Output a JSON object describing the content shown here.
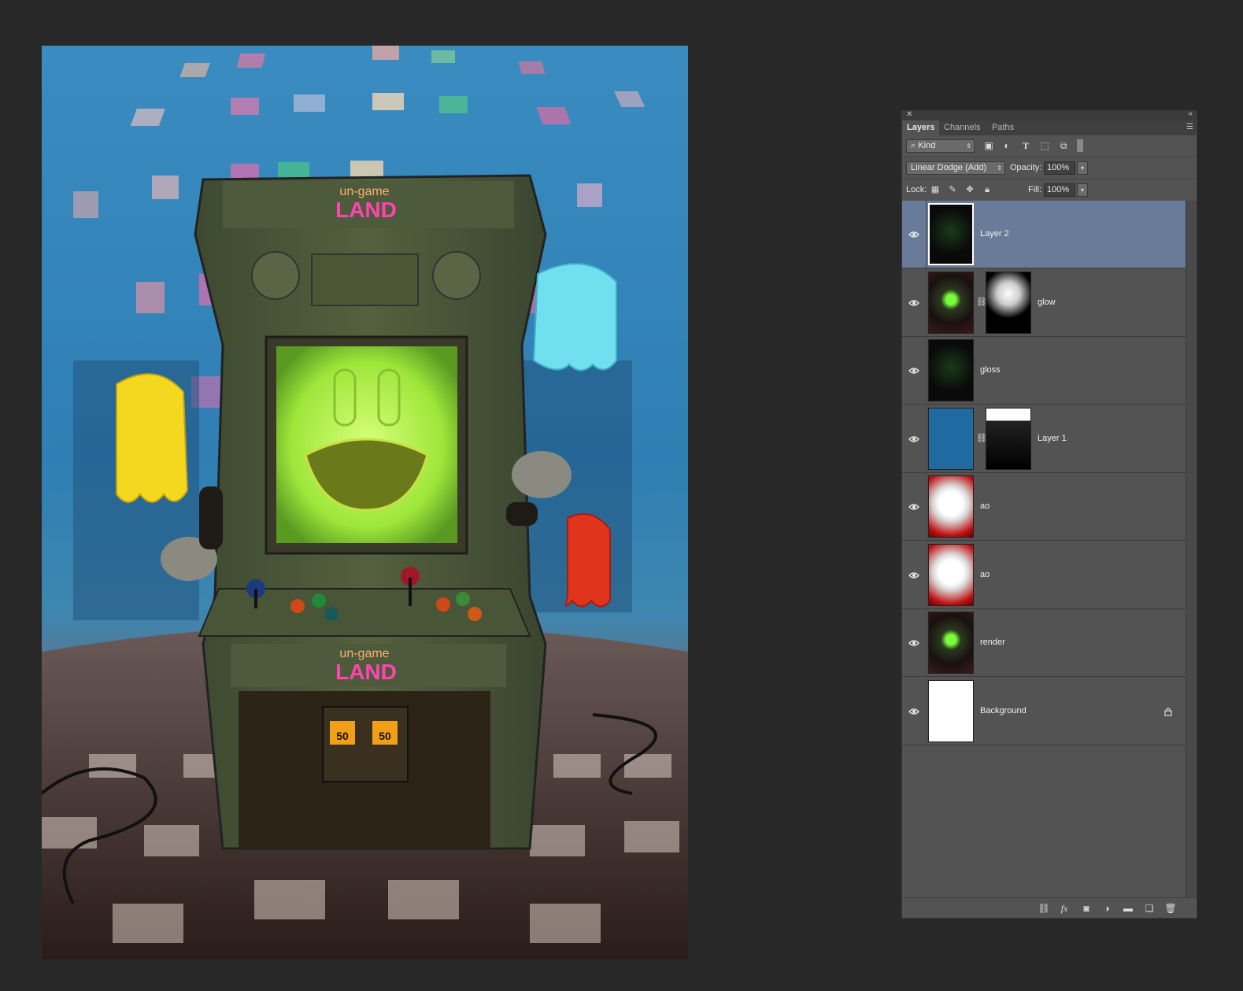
{
  "panel": {
    "tabs": [
      "Layers",
      "Channels",
      "Paths"
    ],
    "active_tab": "Layers",
    "filter": {
      "label": "Kind"
    },
    "blend_mode": "Linear Dodge (Add)",
    "opacity_label": "Opacity:",
    "opacity": "100%",
    "lock_label": "Lock:",
    "fill_label": "Fill:",
    "fill": "100%",
    "layers": [
      {
        "name": "Layer 2",
        "selected": true,
        "thumb": "dark-render",
        "mask": null,
        "locked": false
      },
      {
        "name": "glow",
        "selected": false,
        "thumb": "render",
        "mask": "radial-white",
        "locked": false
      },
      {
        "name": "gloss",
        "selected": false,
        "thumb": "dark-render",
        "mask": null,
        "locked": false
      },
      {
        "name": "Layer 1",
        "selected": false,
        "thumb": "solid-blue",
        "mask": "silhouette",
        "locked": false
      },
      {
        "name": "ao",
        "selected": false,
        "thumb": "ao",
        "mask": null,
        "locked": false
      },
      {
        "name": "ao",
        "selected": false,
        "thumb": "ao",
        "mask": null,
        "locked": false
      },
      {
        "name": "render",
        "selected": false,
        "thumb": "render",
        "mask": null,
        "locked": false
      },
      {
        "name": "Background",
        "selected": false,
        "thumb": "white",
        "mask": null,
        "locked": true
      }
    ]
  },
  "artwork": {
    "marquee_text_1": "un-game",
    "marquee_text_2": "LAND",
    "coin_left": "50",
    "coin_right": "50"
  },
  "colors": {
    "app_bg": "#282828",
    "panel_bg": "#535353",
    "selected_row": "#6a7b99",
    "layer1_fill": "#1f6aa0"
  }
}
